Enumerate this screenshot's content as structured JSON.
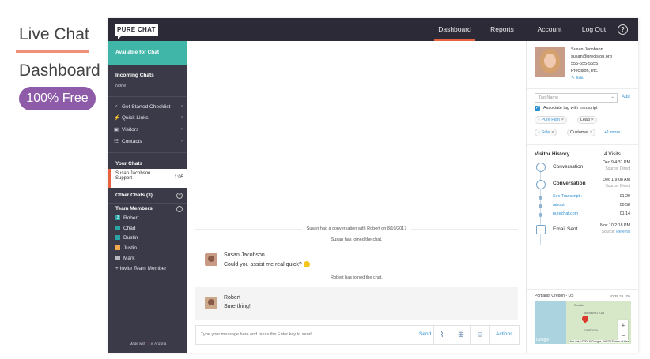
{
  "promo": {
    "title": "Live Chat",
    "subtitle": "Dashboard",
    "badge": "100% Free"
  },
  "brand": {
    "logo": "PURE CHAT"
  },
  "nav": {
    "items": [
      {
        "label": "Dashboard",
        "active": true
      },
      {
        "label": "Reports"
      },
      {
        "label": "Account"
      },
      {
        "label": "Log Out"
      }
    ],
    "help": "?"
  },
  "sidebar": {
    "status": "Available for Chat",
    "incoming_title": "Incoming Chats",
    "incoming_none": "None",
    "menu": [
      {
        "label": "Get Started Checklist",
        "icon": "check-icon"
      },
      {
        "label": "Quick Links",
        "icon": "bolt-icon"
      },
      {
        "label": "Visitors",
        "icon": "monitor-icon"
      },
      {
        "label": "Contacts",
        "icon": "contacts-icon"
      }
    ],
    "your_chats_title": "Your Chats",
    "active_chat": {
      "name": "Susan Jacobson",
      "dept": "Support",
      "time": "1:05"
    },
    "other_chats": "Other Chats (3)",
    "team_title": "Team Members",
    "members": [
      {
        "name": "Robert",
        "color": "#2aa4a4",
        "badge": "3"
      },
      {
        "name": "Chad",
        "color": "#2aa4a4"
      },
      {
        "name": "Dustin",
        "color": "#2aa4a4"
      },
      {
        "name": "Justin",
        "color": "#f0a94a"
      },
      {
        "name": "Mark",
        "color": "#b9b9c2"
      }
    ],
    "invite": "+ Invite Team Member",
    "made_with": "Made with",
    "made_in": "in Arizona"
  },
  "chat": {
    "sys_conversation": "Susan had a conversation with Robert on 8/10/2017",
    "sys_susan_joined": "Susan has joined the chat.",
    "msg1": {
      "name": "Susan Jacobson",
      "text": "Could you assist me real quick?"
    },
    "sys_robert_joined": "Robert has joined the chat.",
    "msg2": {
      "name": "Robert",
      "text": "Sure thing!"
    },
    "composer_placeholder": "Type your message here and press the Enter key to send.",
    "send": "Send",
    "actions": "Actions"
  },
  "profile": {
    "name": "Susan Jacobson",
    "email": "susan@precision.org",
    "phone": "555-555-5555",
    "company": "Precision, Inc.",
    "edit": "Edit",
    "tag_placeholder": "Tag Name",
    "add": "Add",
    "associate_label": "Associate tag with transcript",
    "tags": [
      {
        "label": "Pure Plan",
        "blue": true
      },
      {
        "label": "Lead"
      },
      {
        "label": "Sale",
        "blue": true
      },
      {
        "label": "Customer"
      }
    ],
    "more_tags": "+1 more"
  },
  "history": {
    "title": "Visitor History",
    "count": "4 Visits",
    "entries": [
      {
        "label": "Conversation",
        "date": "Dec 9 4:31 PM",
        "source_label": "Source:",
        "source": "Direct"
      },
      {
        "label": "Conversation",
        "date": "Dec 1 9:08 AM",
        "source_label": "Source:",
        "source": "Direct"
      },
      {
        "label": "Email Sent",
        "date": "Nov 10 2:18 PM",
        "source_label": "Source:",
        "source": "Referral"
      }
    ],
    "sub_items": [
      {
        "label": "See Transcript",
        "duration": "01:29"
      },
      {
        "label": "/about",
        "duration": "00:58"
      },
      {
        "label": "purechat.com",
        "duration": "01:14"
      }
    ]
  },
  "map": {
    "location": "Portland, Oregon - US",
    "ip": "10.39.26.105",
    "zoom_in": "+",
    "zoom_out": "−",
    "credit": "Map data ©2016 Google, INEGI  Terms of Use",
    "label_wa": "WASHINGTON",
    "label_or": "OREGON",
    "label_seattle": "Seattle",
    "label_portland": "Portland",
    "label_google": "Google"
  }
}
